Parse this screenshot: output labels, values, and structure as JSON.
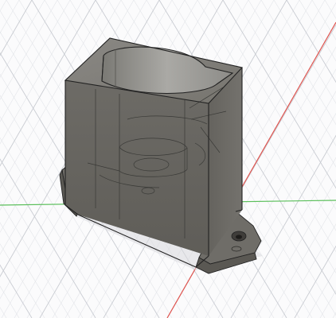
{
  "viewport": {
    "background": "#fbfbfc",
    "grid_minor_color": "#e3e5e9",
    "grid_major_color": "#c9ccd2",
    "x_axis_color": "#e0544f",
    "y_axis_color": "#5bbf5b"
  },
  "model": {
    "body_color": "#6f6d68",
    "body_dark_color": "#5a5853",
    "edge_color": "#222222",
    "hidden_line_color": "#3a3a37",
    "bore_inner_color": "#9c9b97",
    "shadow_color": "#d8d9dc"
  }
}
